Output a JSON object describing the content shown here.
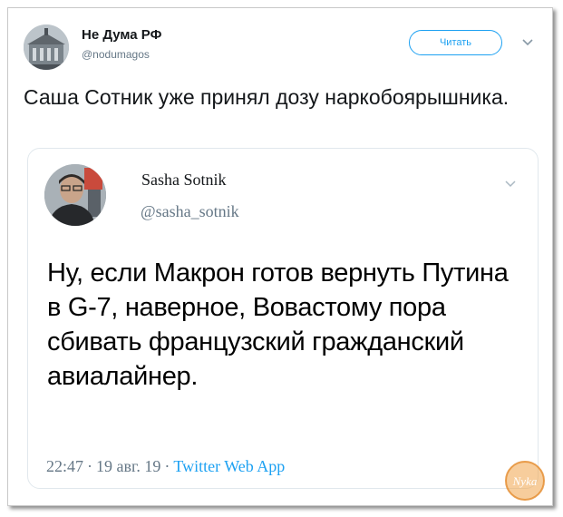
{
  "tweet": {
    "author_name": "Не Дума РФ",
    "author_handle": "@nodumagos",
    "follow_label": "Читать",
    "text": "Саша Сотник уже принял дозу наркобоярышника.",
    "options_icon": "chevron-down-icon"
  },
  "quoted": {
    "author_name": "Sasha Sotnik",
    "author_handle": "@sasha_sotnik",
    "text": "Ну, если Макрон готов вернуть Путина в G-7, наверное, Вовастому пора сбивать французский гражданский авиалайнер.",
    "time": "22:47",
    "date": "19 авг. 19",
    "separator": "·",
    "source": "Twitter Web App",
    "options_icon": "chevron-down-icon"
  },
  "watermark": {
    "icon": "watermark-logo-icon",
    "text": "Nyka"
  },
  "colors": {
    "accent": "#1da1f2",
    "muted": "#657786",
    "text": "#14171a",
    "border": "#e1e8ed",
    "watermark": "#e38a2a"
  }
}
